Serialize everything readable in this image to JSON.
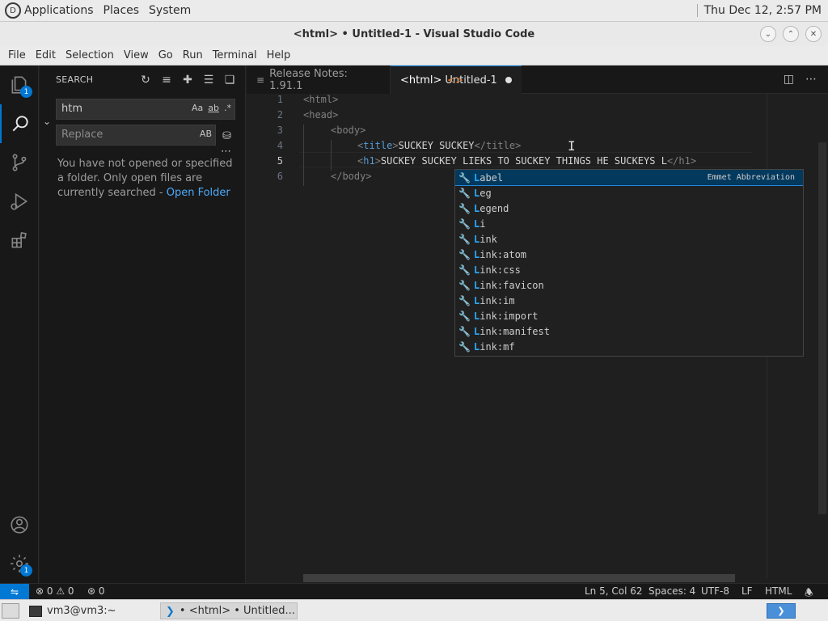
{
  "panel": {
    "menus": [
      "Applications",
      "Places",
      "System"
    ],
    "datetime": "Thu Dec 12,  2:57 PM"
  },
  "window": {
    "title": "<html> • Untitled-1 - Visual Studio Code"
  },
  "menubar": [
    "File",
    "Edit",
    "Selection",
    "View",
    "Go",
    "Run",
    "Terminal",
    "Help"
  ],
  "activity": {
    "explorer_badge": "1",
    "settings_badge": "1"
  },
  "search": {
    "title": "SEARCH",
    "query": "htm",
    "replace_placeholder": "Replace",
    "case_opt": "Aa",
    "word_opt": "ab",
    "regex_opt": ".*",
    "preserve_case": "AB",
    "message": "You have not opened or specified a folder. Only open files are currently searched -",
    "open_folder": "Open Folder"
  },
  "tabs": [
    {
      "label": "Release Notes: 1.91.1"
    },
    {
      "label_tag": "<html>",
      "label_file": "Untitled-1"
    }
  ],
  "editor": {
    "line_numbers": [
      "1",
      "2",
      "3",
      "4",
      "5",
      "6"
    ],
    "lines": {
      "l1_open": "<",
      "l1_tag": "html",
      "l1_close": ">",
      "l2_open": "<",
      "l2_tag": "head",
      "l2_close": ">",
      "l3_open": "<",
      "l3_tag": "body",
      "l3_close": ">",
      "l4_tag_open": "title",
      "l4_text": "SUCKEY SUCKEY",
      "l4_tag_close": "/title",
      "l5_tag_open": "h1",
      "l5_text": "SUCKEY SUCKEY LIEKS TO SUCKEY THINGS HE SUCKEYS L",
      "l5_tag_close": "/h1",
      "l6_tag": "/body"
    }
  },
  "suggestions": {
    "detail": "Emmet Abbreviation",
    "items": [
      {
        "match": "L",
        "rest": "abel"
      },
      {
        "match": "L",
        "rest": "eg"
      },
      {
        "match": "L",
        "rest": "egend"
      },
      {
        "match": "L",
        "rest": "i"
      },
      {
        "match": "L",
        "rest": "ink"
      },
      {
        "match": "L",
        "rest": "ink:atom"
      },
      {
        "match": "L",
        "rest": "ink:css"
      },
      {
        "match": "L",
        "rest": "ink:favicon"
      },
      {
        "match": "L",
        "rest": "ink:im"
      },
      {
        "match": "L",
        "rest": "ink:import"
      },
      {
        "match": "L",
        "rest": "ink:manifest"
      },
      {
        "match": "L",
        "rest": "ink:mf"
      }
    ]
  },
  "status": {
    "errors": "0",
    "warnings": "0",
    "ports": "0",
    "position": "Ln 5, Col 62",
    "spaces": "Spaces: 4",
    "encoding": "UTF-8",
    "eol": "LF",
    "language": "HTML"
  },
  "taskbar": {
    "terminal": "vm3@vm3:~",
    "vscode": "• <html> • Untitled..."
  },
  "colors": {
    "accent": "#0078d4",
    "tag": "#569cd6",
    "match": "#2aaaff"
  }
}
